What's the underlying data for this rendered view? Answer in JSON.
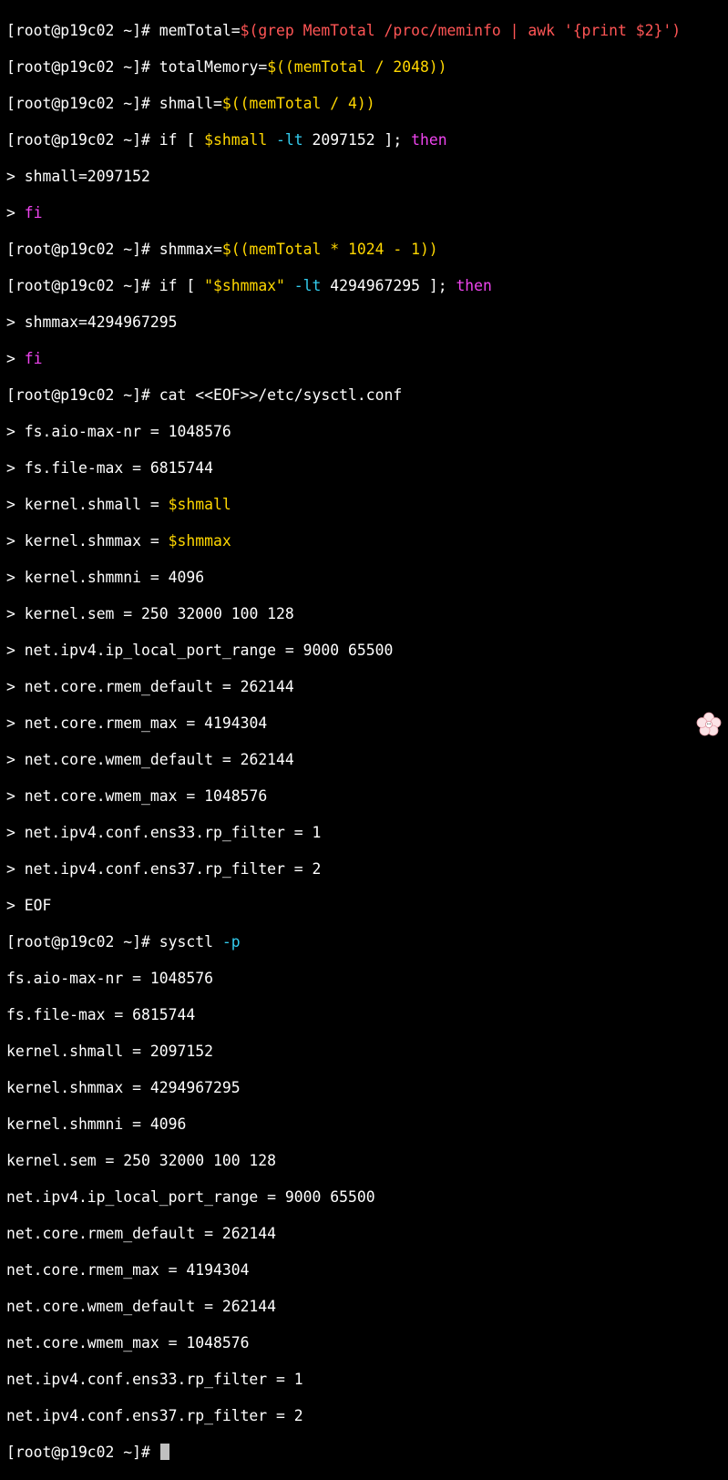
{
  "colors": {
    "background": "#000000",
    "text": "#ffffff",
    "string_red": "#ff5555",
    "expansion_yellow": "#ffd700",
    "keyword_magenta": "#ee44ee",
    "option_cyan": "#33ccee",
    "cursor": "#c0c0c0"
  },
  "prompt": "[root@p19c02 ~]# ",
  "cont": "> ",
  "cmd1": {
    "a": "memTotal=",
    "b": "$(grep MemTotal /proc/meminfo | awk '{print $2}')"
  },
  "cmd2": {
    "a": "totalMemory=",
    "b": "$((memTotal / 2048))"
  },
  "cmd3": {
    "a": "shmall=",
    "b": "$((memTotal / 4))"
  },
  "cmd4": {
    "a": "if [ ",
    "b": "$shmall",
    "c": " -lt",
    "d": " 2097152 ]; ",
    "e": "then"
  },
  "cmd4_body": "shmall=2097152",
  "fi": "fi",
  "cmd5": {
    "a": "shmmax=",
    "b": "$((memTotal * 1024 - 1))"
  },
  "cmd6": {
    "a": "if [ ",
    "b": "\"$shmmax\"",
    "c": " -lt",
    "d": " 4294967295 ]; ",
    "e": "then"
  },
  "cmd6_body": "shmmax=4294967295",
  "cmd7": "cat <<EOF>>/etc/sysctl.conf",
  "heredoc": {
    "aio": "fs.aio-max-nr = 1048576",
    "filemax": "fs.file-max = 6815744",
    "shmall_key": "kernel.shmall = ",
    "shmall_val": "$shmall",
    "shmmax_key": "kernel.shmmax = ",
    "shmmax_val": "$shmmax",
    "shmmni": "kernel.shmmni = 4096",
    "sem": "kernel.sem = 250 32000 100 128",
    "portrange": "net.ipv4.ip_local_port_range = 9000 65500",
    "rmem_default": "net.core.rmem_default = 262144",
    "rmem_max": "net.core.rmem_max = 4194304",
    "wmem_default": "net.core.wmem_default = 262144",
    "wmem_max": "net.core.wmem_max = 1048576",
    "rp33": "net.ipv4.conf.ens33.rp_filter = 1",
    "rp37": "net.ipv4.conf.ens37.rp_filter = 2",
    "eof": "EOF"
  },
  "cmd8": {
    "a": "sysctl",
    "b": " -p"
  },
  "output": [
    "fs.aio-max-nr = 1048576",
    "fs.file-max = 6815744",
    "kernel.shmall = 2097152",
    "kernel.shmmax = 4294967295",
    "kernel.shmmni = 4096",
    "kernel.sem = 250 32000 100 128",
    "net.ipv4.ip_local_port_range = 9000 65500",
    "net.core.rmem_default = 262144",
    "net.core.rmem_max = 4194304",
    "net.core.wmem_default = 262144",
    "net.core.wmem_max = 1048576",
    "net.ipv4.conf.ens33.rp_filter = 1",
    "net.ipv4.conf.ens37.rp_filter = 2"
  ],
  "icons": {
    "badge": "flower-watermark-icon"
  }
}
